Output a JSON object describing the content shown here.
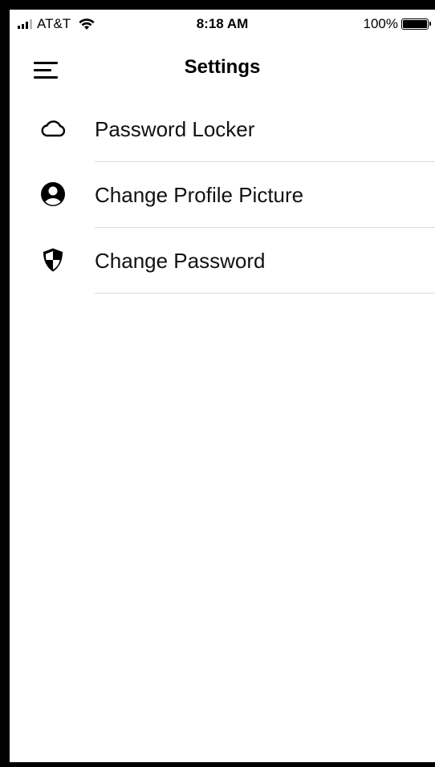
{
  "status_bar": {
    "carrier": "AT&T",
    "time": "8:18 AM",
    "battery_percent": "100%",
    "battery_level": 1.0
  },
  "nav": {
    "title": "Settings",
    "menu_icon": "hamburger-menu-icon"
  },
  "settings": {
    "items": [
      {
        "label": "Password Locker",
        "icon": "cloud-icon"
      },
      {
        "label": "Change Profile Picture",
        "icon": "user-circle-icon"
      },
      {
        "label": "Change Password",
        "icon": "shield-icon"
      }
    ]
  }
}
